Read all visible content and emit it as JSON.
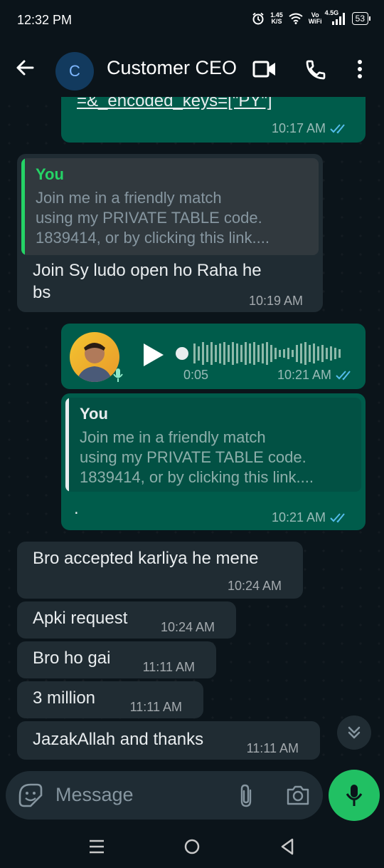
{
  "status_bar": {
    "time": "12:32 PM",
    "speed_value": "1.45",
    "speed_unit": "K/S",
    "vowifi_top": "Vo",
    "vowifi_bottom": "WiFi",
    "network": "4.5G",
    "battery": "53"
  },
  "header": {
    "avatar_letter": "C",
    "contact_name": "Customer CEO"
  },
  "messages": {
    "m0": {
      "text": "=&_encoded_keys=[\"PY\"]",
      "time": "10:17 AM"
    },
    "m1": {
      "quote_author": "You",
      "quote_line1": "Join me in a friendly match",
      "quote_line2": "using my PRIVATE TABLE code.",
      "quote_line3": "1839414, or by clicking this link....",
      "text_line1": "Join Sy ludo open ho Raha he",
      "text_line2": "bs",
      "time": "10:19 AM"
    },
    "m2": {
      "duration": "0:05",
      "time": "10:21 AM"
    },
    "m3": {
      "quote_author": "You",
      "quote_line1": "Join me in a friendly match",
      "quote_line2": "using my PRIVATE TABLE code.",
      "quote_line3": "1839414, or by clicking this link....",
      "text": ".",
      "time": "10:21 AM"
    },
    "m4": {
      "text": "Bro accepted karliya he mene",
      "time": "10:24 AM"
    },
    "m5": {
      "text": "Apki request",
      "time": "10:24 AM"
    },
    "m6": {
      "text": "Bro ho gai",
      "time": "11:11 AM"
    },
    "m7": {
      "text": "3 million",
      "time": "11:11 AM"
    },
    "m8": {
      "text": "JazakAllah and thanks",
      "time": "11:11 AM"
    }
  },
  "composer": {
    "placeholder": "Message"
  },
  "colors": {
    "background": "#0b141a",
    "outgoing_bubble": "#005c4b",
    "incoming_bubble": "#202c33",
    "accent_green": "#21c063",
    "read_tick": "#53bdeb"
  }
}
